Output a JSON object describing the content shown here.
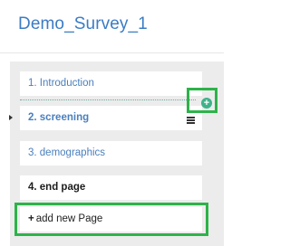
{
  "survey": {
    "title": "Demo_Survey_1"
  },
  "pages": [
    {
      "label": "1. Introduction"
    },
    {
      "label": "2. screening"
    },
    {
      "label": "3. demographics"
    },
    {
      "label": "4. end page"
    }
  ],
  "controls": {
    "add_between_icon": "plus-circle-icon",
    "add_between_glyph": "+",
    "page_menu_icon": "hamburger-menu-icon",
    "add_page_glyph": "+",
    "add_page_label": "add new Page"
  },
  "colors": {
    "title": "#3b7cc4",
    "page_link": "#4a7fbd",
    "panel_bg": "#ececec",
    "highlight": "#2db34a",
    "add_icon": "#3fb28a"
  }
}
